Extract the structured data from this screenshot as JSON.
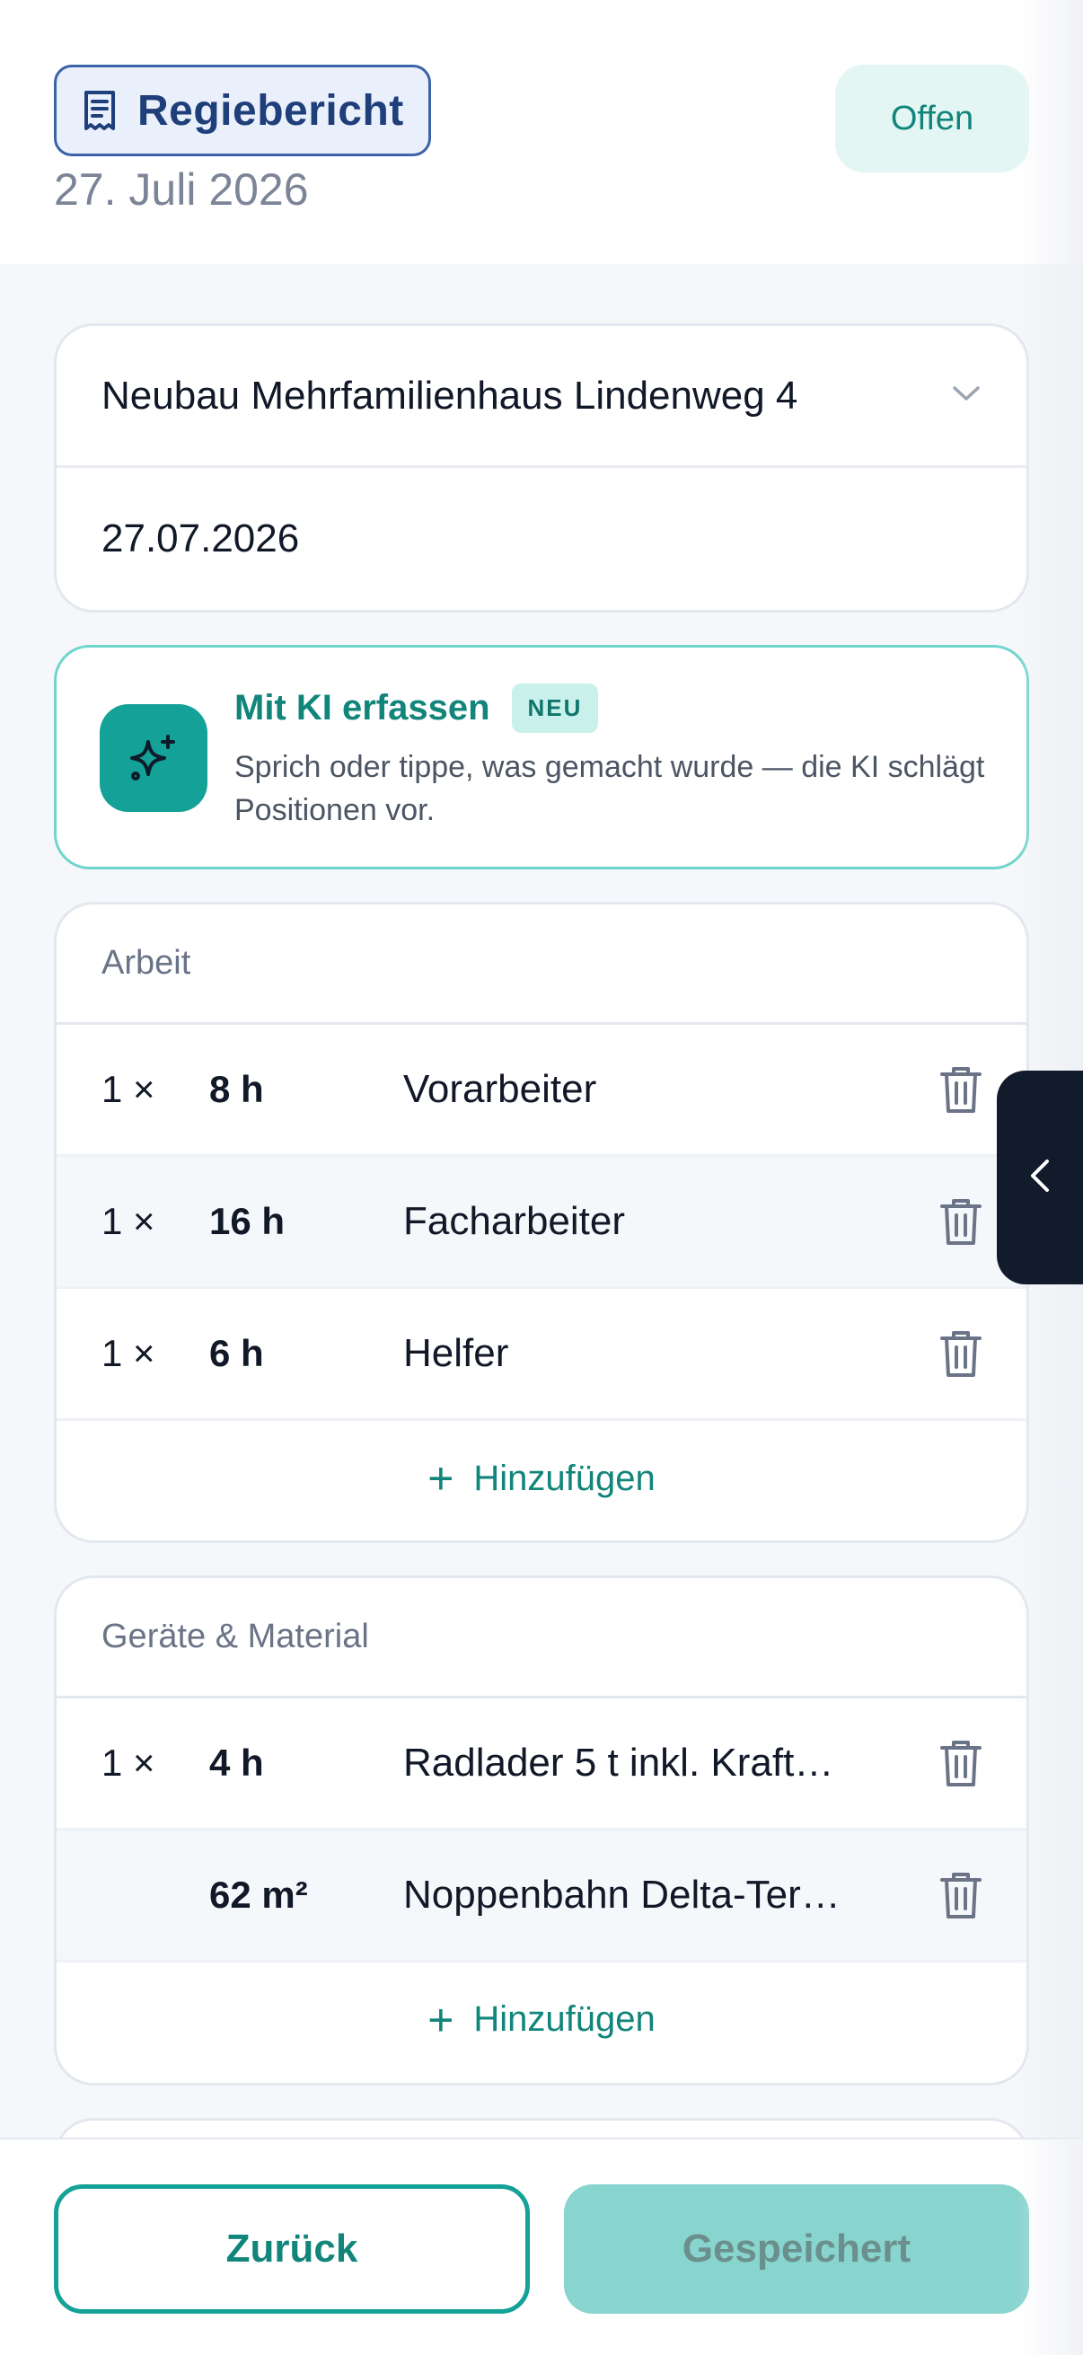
{
  "header": {
    "title": "Regiebericht",
    "date": "27. Juli 2026",
    "status": "Offen"
  },
  "project": {
    "name": "Neubau Mehrfamilienhaus Lindenweg 4",
    "date": "27.07.2026"
  },
  "ai": {
    "title": "Mit KI erfassen",
    "badge": "NEU",
    "description": "Sprich oder tippe, was gemacht wurde — die KI schlägt Positionen vor."
  },
  "work": {
    "title": "Arbeit",
    "items": [
      {
        "qty": "1 ×",
        "amount": "8 h",
        "desc": "Vorarbeiter"
      },
      {
        "qty": "1 ×",
        "amount": "16 h",
        "desc": "Facharbeiter"
      },
      {
        "qty": "1 ×",
        "amount": "6 h",
        "desc": "Helfer"
      }
    ],
    "add_label": "Hinzufügen"
  },
  "equipment": {
    "title": "Geräte & Material",
    "items": [
      {
        "qty": "1 ×",
        "amount": "4 h",
        "desc": "Radlader 5 t inkl. Kraft…"
      },
      {
        "qty": "",
        "amount": "62 m²",
        "desc": "Noppenbahn Delta-Ter…"
      }
    ],
    "add_label": "Hinzufügen"
  },
  "footer": {
    "back_label": "Zurück",
    "save_label": "Gespeichert"
  },
  "colors": {
    "accent": "#14a197",
    "title_blue": "#1f3f7a",
    "dark_tab": "#121b2c"
  }
}
